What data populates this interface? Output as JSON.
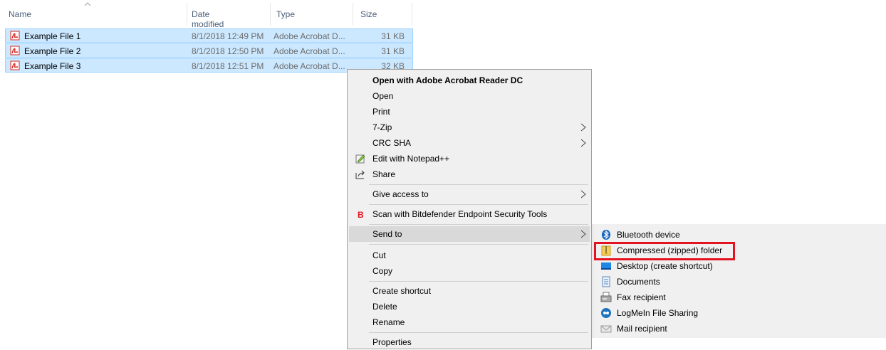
{
  "columns": {
    "name": "Name",
    "date": "Date modified",
    "type": "Type",
    "size": "Size"
  },
  "files": [
    {
      "name": "Example File 1",
      "date": "8/1/2018 12:49 PM",
      "type": "Adobe Acrobat D...",
      "size": "31 KB"
    },
    {
      "name": "Example File 2",
      "date": "8/1/2018 12:50 PM",
      "type": "Adobe Acrobat D...",
      "size": "31 KB"
    },
    {
      "name": "Example File 3",
      "date": "8/1/2018 12:51 PM",
      "type": "Adobe Acrobat D...",
      "size": "32 KB"
    }
  ],
  "menu": {
    "open_with": "Open with Adobe Acrobat Reader DC",
    "open": "Open",
    "print": "Print",
    "zip": "7-Zip",
    "crc": "CRC SHA",
    "notepad": "Edit with Notepad++",
    "share": "Share",
    "give_access": "Give access to",
    "bitdefender": "Scan with Bitdefender Endpoint Security Tools",
    "send_to": "Send to",
    "cut": "Cut",
    "copy": "Copy",
    "create_shortcut": "Create shortcut",
    "delete": "Delete",
    "rename": "Rename",
    "properties": "Properties"
  },
  "submenu": {
    "bluetooth": "Bluetooth device",
    "compressed": "Compressed (zipped) folder",
    "desktop": "Desktop (create shortcut)",
    "documents": "Documents",
    "fax": "Fax recipient",
    "logmein": "LogMeIn File Sharing",
    "mail": "Mail recipient"
  },
  "colors": {
    "selection": "#cce8ff",
    "menu_bg": "#f0f0f0",
    "highlight": "#e3141f",
    "pdf_red": "#d7261e"
  }
}
